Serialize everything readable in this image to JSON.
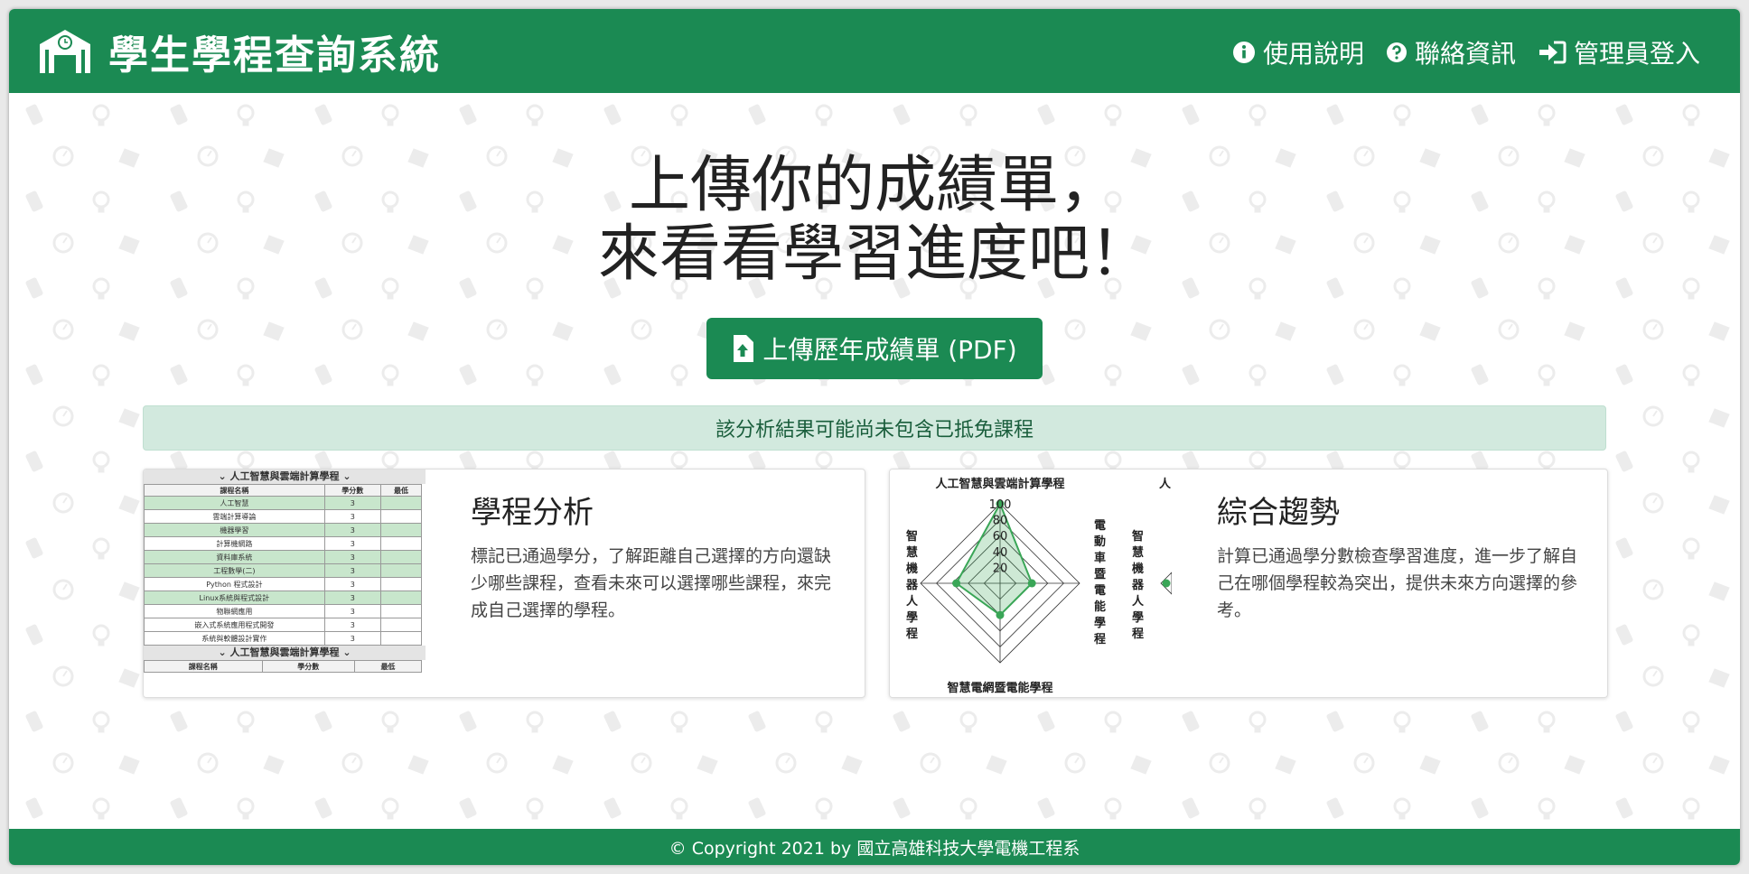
{
  "header": {
    "title": "學生學程查詢系統",
    "nav": [
      {
        "label": "使用說明",
        "icon": "info-circle-icon"
      },
      {
        "label": "聯絡資訊",
        "icon": "question-circle-icon"
      },
      {
        "label": "管理員登入",
        "icon": "sign-in-icon"
      }
    ]
  },
  "hero": {
    "line1": "上傳你的成績單，",
    "line2": "來看看學習進度吧！"
  },
  "upload_button": {
    "label": "上傳歷年成績單 (PDF)",
    "icon": "file-upload-icon"
  },
  "alert": {
    "text": "該分析結果可能尚未包含已抵免課程"
  },
  "cards": [
    {
      "title": "學程分析",
      "text": "標記已通過學分，了解距離自己選擇的方向還缺少哪些課程，查看未來可以選擇哪些課程，來完成自己選擇的學程。",
      "preview": {
        "heading1": "人工智慧與雲端計算學程",
        "heading2": "人工智慧與雲端計算學程",
        "columns": [
          "課程名稱",
          "學分數",
          "最低"
        ],
        "rows": [
          {
            "name": "人工智慧",
            "credits": "3",
            "passed": true
          },
          {
            "name": "雲端計算導論",
            "credits": "3",
            "passed": false
          },
          {
            "name": "機器學習",
            "credits": "3",
            "passed": true
          },
          {
            "name": "計算機網路",
            "credits": "3",
            "passed": false
          },
          {
            "name": "資料庫系統",
            "credits": "3",
            "passed": true
          },
          {
            "name": "工程數學(二)",
            "credits": "3",
            "passed": true
          },
          {
            "name": "Python 程式設計",
            "credits": "3",
            "passed": false
          },
          {
            "name": "Linux系統與程式設計",
            "credits": "3",
            "passed": true
          },
          {
            "name": "物聯網應用",
            "credits": "3",
            "passed": false
          },
          {
            "name": "嵌入式系統應用程式開發",
            "credits": "3",
            "passed": false
          },
          {
            "name": "系統與軟體設計實作",
            "credits": "3",
            "passed": false
          }
        ]
      }
    },
    {
      "title": "綜合趨勢",
      "text": "計算已通過學分數檢查學習進度，進一步了解自己在哪個學程較為突出，提供未來方向選擇的參考。",
      "preview": {
        "type": "radar",
        "top_label": "人工智慧與雲端計算學程",
        "top_label_cut": "人",
        "left_label": "智慧機器人學程",
        "right_label": "電動車暨電能學程",
        "right_label_2": "智慧機器人學程",
        "bottom_label": "智慧電網暨電能學程",
        "ticks": [
          "100",
          "80",
          "60",
          "40",
          "20"
        ]
      }
    }
  ],
  "chart_data": {
    "type": "radar",
    "categories": [
      "人工智慧與雲端計算學程",
      "電動車暨電能學程",
      "智慧電網暨電能學程",
      "智慧機器人學程"
    ],
    "values": [
      100,
      40,
      40,
      55
    ],
    "rlim": [
      0,
      100
    ],
    "ticks": [
      20,
      40,
      60,
      80,
      100
    ],
    "color": "#3aa657"
  },
  "footer": {
    "text": "© Copyright 2021 by 國立高雄科技大學電機工程系"
  },
  "colors": {
    "primary": "#1b8a53",
    "alert_bg": "#d2e9de"
  }
}
